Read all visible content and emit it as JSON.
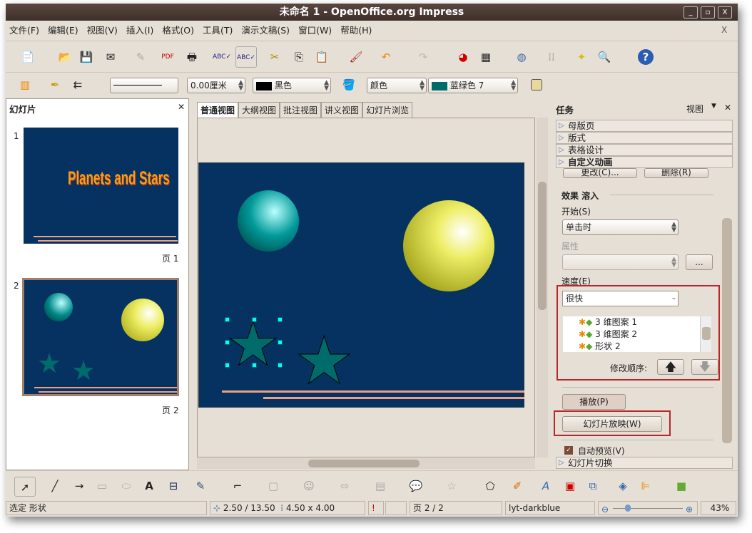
{
  "window": {
    "title": "未命名 1 - OpenOffice.org Impress",
    "min": "_",
    "max": "▫",
    "close": "X"
  },
  "menu": [
    "文件(F)",
    "编辑(E)",
    "视图(V)",
    "插入(I)",
    "格式(O)",
    "工具(T)",
    "演示文稿(S)",
    "窗口(W)",
    "帮助(H)"
  ],
  "menu_close": "X",
  "line_format": {
    "width": "0.00厘米",
    "line_color": "黑色",
    "area_style": "颜色",
    "area_color": "蓝绿色 7"
  },
  "colors": {
    "accent": "#063261",
    "teal": "#006b6b",
    "black": "#000000",
    "highlight": "#b8262a"
  },
  "slides_panel": {
    "title": "幻灯片",
    "close": "✕",
    "slides": [
      {
        "num": "1",
        "title": "Planets and Stars",
        "label": "页 1"
      },
      {
        "num": "2",
        "label": "页 2"
      }
    ]
  },
  "view_tabs": [
    "普通视图",
    "大纲视图",
    "批注视图",
    "讲义视图",
    "幻灯片浏览"
  ],
  "task_pane": {
    "title": "任务",
    "view": "视图",
    "close": "✕",
    "sections": [
      "母版页",
      "版式",
      "表格设计",
      "自定义动画"
    ],
    "change_btn": "更改(C)...",
    "remove_btn": "删除(R)",
    "effect_title": "效果 溶入",
    "start_label": "开始(S)",
    "start_value": "单击时",
    "property_label": "属性",
    "property_btn": "...",
    "speed_label": "速度(E)",
    "speed_value": "很快",
    "anim_list": [
      "3 维图案 1",
      "3 维图案 2",
      "形状 2"
    ],
    "reorder_label": "修改顺序:",
    "play_btn": "播放(P)",
    "slideshow_btn": "幻灯片放映(W)",
    "autopreview": "自动预览(V)",
    "slide_transition": "幻灯片切换"
  },
  "status": {
    "selection": "选定 形状",
    "position": "2.50 / 13.50",
    "size": "4.50 x 4.00",
    "page": "页 2 / 2",
    "master": "lyt-darkblue",
    "zoom": "43%",
    "zoom_level": 43
  }
}
